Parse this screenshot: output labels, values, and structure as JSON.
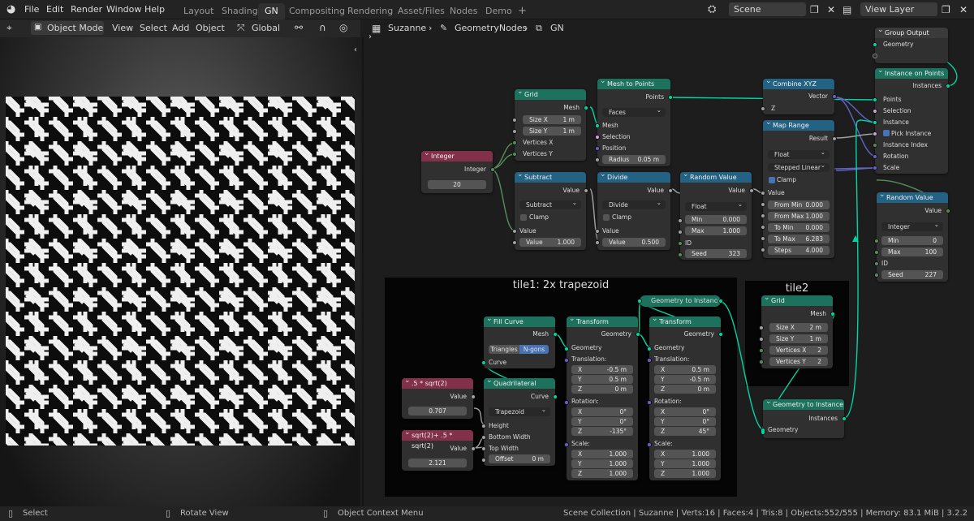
{
  "topbar": {
    "menus": [
      "File",
      "Edit",
      "Render",
      "Window",
      "Help"
    ],
    "tabs": [
      "Layout",
      "Shading",
      "GN",
      "Compositing",
      "Rendering",
      "Asset/Files",
      "Nodes",
      "Demo"
    ],
    "active_tab": "GN",
    "add_tab": "+",
    "scene": "Scene",
    "view_layer": "View Layer"
  },
  "viewport": {
    "mode": "Object Mode",
    "menus": [
      "View",
      "Select",
      "Add",
      "Object"
    ],
    "transform": "Global"
  },
  "breadcrumb": {
    "object": "Suzanne",
    "modifier": "GeometryNodes",
    "tree": "GN"
  },
  "frames": {
    "tile1": "tile1: 2x trapezoid",
    "tile2": "tile2"
  },
  "nodes": {
    "group_output": {
      "title": "Group Output",
      "geometry": "Geometry"
    },
    "instance_on_points": {
      "title": "Instance on Points",
      "instances": "Instances",
      "points": "Points",
      "selection": "Selection",
      "instance": "Instance",
      "pick": "Pick Instance",
      "instance_index": "Instance Index",
      "rotation": "Rotation",
      "scale": "Scale"
    },
    "combine_xyz": {
      "title": "Combine XYZ",
      "vector": "Vector",
      "z": "Z"
    },
    "map_range": {
      "title": "Map Range",
      "result": "Result",
      "type": "Float",
      "interp": "Stepped Linear",
      "clamp": "Clamp",
      "value": "Value",
      "from_min_l": "From Min",
      "from_min": "0.000",
      "from_max_l": "From Max",
      "from_max": "1.000",
      "to_min_l": "To Min",
      "to_min": "0.000",
      "to_max_l": "To Max",
      "to_max": "6.283",
      "steps_l": "Steps",
      "steps": "4.000"
    },
    "random_value_int": {
      "title": "Random Value",
      "value": "Value",
      "type": "Integer",
      "min_l": "Min",
      "min": "0",
      "max_l": "Max",
      "max": "100",
      "id": "ID",
      "seed_l": "Seed",
      "seed": "227"
    },
    "grid": {
      "title": "Grid",
      "mesh": "Mesh",
      "sx_l": "Size X",
      "sx": "1 m",
      "sy_l": "Size Y",
      "sy": "1 m",
      "vx": "Vertices X",
      "vy": "Vertices Y"
    },
    "mesh_to_points": {
      "title": "Mesh to Points",
      "points": "Points",
      "mode": "Faces",
      "mesh": "Mesh",
      "selection": "Selection",
      "position": "Position",
      "radius_l": "Radius",
      "radius": "0.05 m"
    },
    "integer": {
      "title": "Integer",
      "integer": "Integer",
      "value": "20"
    },
    "subtract": {
      "title": "Subtract",
      "value": "Value",
      "op": "Subtract",
      "clamp": "Clamp",
      "in_value": "Value",
      "v2_l": "Value",
      "v2": "1.000"
    },
    "divide": {
      "title": "Divide",
      "value": "Value",
      "op": "Divide",
      "clamp": "Clamp",
      "in_value": "Value",
      "v2_l": "Value",
      "v2": "0.500"
    },
    "random_value_float": {
      "title": "Random Value",
      "value": "Value",
      "type": "Float",
      "min_l": "Min",
      "min": "0.000",
      "max_l": "Max",
      "max": "1.000",
      "id": "ID",
      "seed_l": "Seed",
      "seed": "323"
    },
    "fill_curve": {
      "title": "Fill Curve",
      "mesh": "Mesh",
      "opt1": "Triangles",
      "opt2": "N-gons",
      "curve": "Curve"
    },
    "quadrilateral": {
      "title": "Quadrilateral",
      "curve": "Curve",
      "mode": "Trapezoid",
      "height": "Height",
      "bottom": "Bottom Width",
      "top": "Top Width",
      "offset_l": "Offset",
      "offset": "0 m"
    },
    "expr1": {
      "title": ".5 * sqrt(2)",
      "value_l": "Value",
      "value": "0.707"
    },
    "expr2": {
      "title": "sqrt(2)+ .5 * sqrt(2)",
      "value_l": "Value",
      "value": "2.121"
    },
    "transform1": {
      "title": "Transform",
      "geometry_out": "Geometry",
      "geometry": "Geometry",
      "translation": "Translation:",
      "t": [
        "-0.5 m",
        "0.5 m",
        "0 m"
      ],
      "rotation": "Rotation:",
      "r": [
        "0°",
        "0°",
        "-135°"
      ],
      "scale": "Scale:",
      "s": [
        "1.000",
        "1.000",
        "1.000"
      ]
    },
    "transform2": {
      "title": "Transform",
      "geometry_out": "Geometry",
      "geometry": "Geometry",
      "translation": "Translation:",
      "t": [
        "0.5 m",
        "-0.5 m",
        "0 m"
      ],
      "rotation": "Rotation:",
      "r": [
        "0°",
        "0°",
        "45°"
      ],
      "scale": "Scale:",
      "s": [
        "1.000",
        "1.000",
        "1.000"
      ]
    },
    "geo_to_inst_top": {
      "title": "Geometry to Instance"
    },
    "grid2": {
      "title": "Grid",
      "mesh": "Mesh",
      "sx_l": "Size X",
      "sx": "2 m",
      "sy_l": "Size Y",
      "sy": "1 m",
      "vx_l": "Vertices X",
      "vx": "2",
      "vy_l": "Vertices Y",
      "vy": "2"
    },
    "geo_to_inst": {
      "title": "Geometry to Instance",
      "instances": "Instances",
      "geometry": "Geometry"
    }
  },
  "axes": [
    "X",
    "Y",
    "Z"
  ],
  "status": {
    "select": "Select",
    "rotate": "Rotate View",
    "context": "Object Context Menu",
    "stats": "Scene Collection | Suzanne | Verts:16 | Faces:4 | Tris:8 | Objects:552/555 | Memory: 83.1 MiB | 3.2.2"
  },
  "colors": {
    "input_header": "#83314a",
    "geometry_header": "#1d725e",
    "converter_header": "#246283",
    "wire_geometry": "#00d6a3",
    "wire_vector": "#6363c7"
  }
}
